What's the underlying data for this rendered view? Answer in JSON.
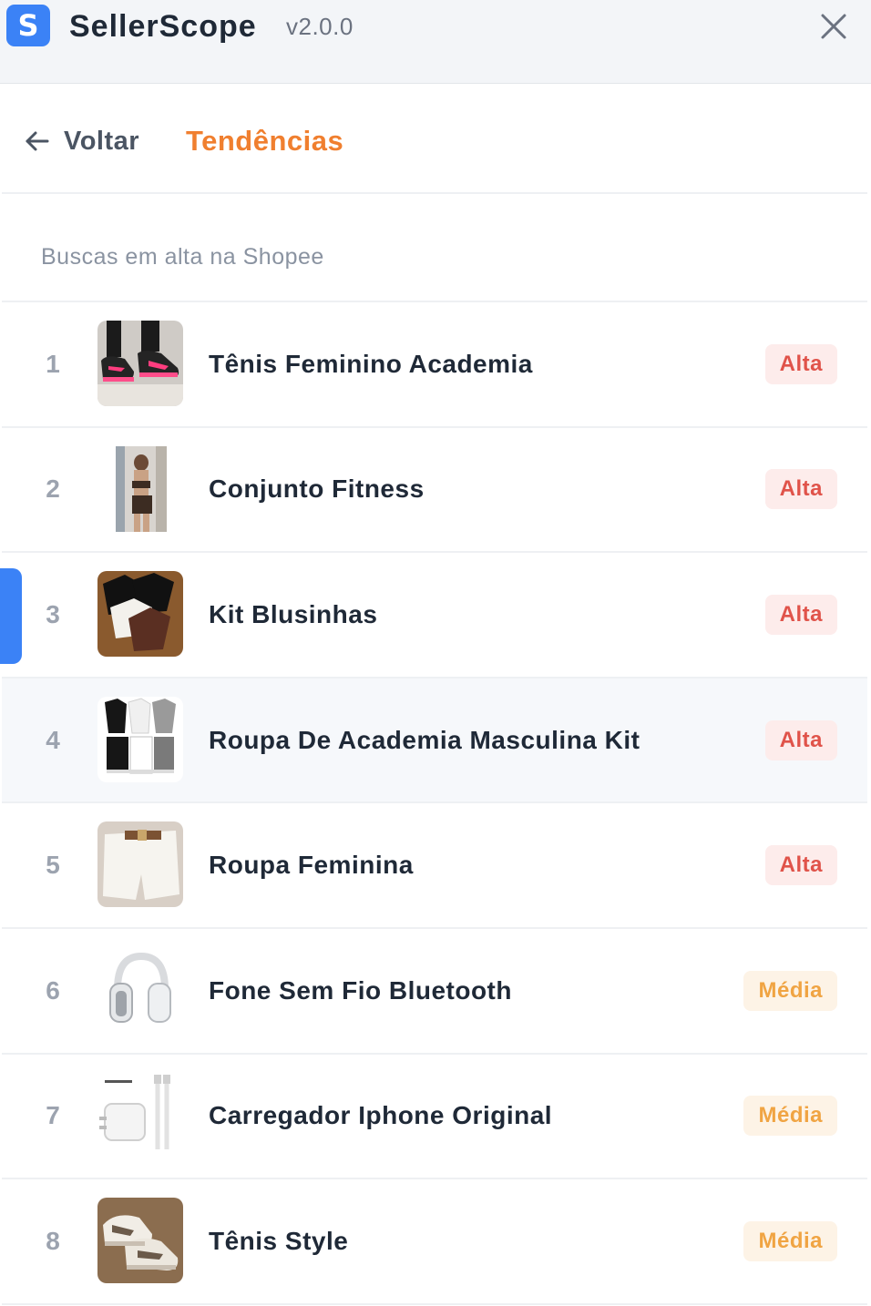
{
  "app": {
    "logo_letter": "S",
    "name": "SellerScope",
    "version": "v2.0.0"
  },
  "nav": {
    "back_label": "Voltar",
    "title": "Tendências"
  },
  "section": {
    "title": "Buscas em alta na Shopee"
  },
  "colors": {
    "accent_blue": "#3b82f6",
    "title_orange": "#f07f2f",
    "badge_alta_text": "#e0534a",
    "badge_alta_bg": "#fdeceb",
    "badge_media_text": "#f0a443",
    "badge_media_bg": "#fdf3e6"
  },
  "trends": [
    {
      "rank": "1",
      "name": "Tênis Feminino Academia",
      "level": "Alta",
      "thumb": "sneaker-pink-thumbnail"
    },
    {
      "rank": "2",
      "name": "Conjunto Fitness",
      "level": "Alta",
      "thumb": "fitness-set-thumbnail"
    },
    {
      "rank": "3",
      "name": "Kit Blusinhas",
      "level": "Alta",
      "thumb": "blouses-kit-thumbnail"
    },
    {
      "rank": "4",
      "name": "Roupa De Academia Masculina Kit",
      "level": "Alta",
      "thumb": "mens-gym-kit-thumbnail"
    },
    {
      "rank": "5",
      "name": "Roupa Feminina",
      "level": "Alta",
      "thumb": "white-shorts-thumbnail"
    },
    {
      "rank": "6",
      "name": "Fone Sem Fio Bluetooth",
      "level": "Média",
      "thumb": "headphones-thumbnail"
    },
    {
      "rank": "7",
      "name": "Carregador Iphone Original",
      "level": "Média",
      "thumb": "charger-thumbnail"
    },
    {
      "rank": "8",
      "name": "Tênis Style",
      "level": "Média",
      "thumb": "style-sneaker-thumbnail"
    }
  ]
}
